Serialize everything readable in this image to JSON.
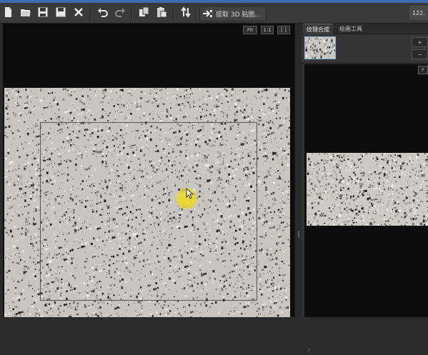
{
  "toolbar": {
    "buttons": [
      {
        "name": "new-file-icon"
      },
      {
        "name": "open-folder-icon"
      },
      {
        "name": "save-icon"
      },
      {
        "name": "save-as-icon"
      },
      {
        "name": "close-x-icon"
      },
      {
        "name": "undo-icon"
      },
      {
        "name": "redo-icon"
      },
      {
        "name": "copy-icon"
      },
      {
        "name": "paste-icon"
      },
      {
        "name": "swap-icon"
      }
    ],
    "extract_label": "提取 3D 贴图...",
    "zoom_readout": "122."
  },
  "viewport": {
    "fit_label": "Fit",
    "one_to_one_label": "1:1",
    "bracket_label": "[ ]"
  },
  "panel": {
    "tabs": [
      {
        "label": "纹理合成",
        "active": true
      },
      {
        "label": "绘画工具",
        "active": false
      }
    ],
    "plus_label": "+",
    "minus_label": "−",
    "preview_tag": "F",
    "help_label": "?"
  },
  "colors": {
    "accent_strip": "#3d6fb0",
    "toolbar_bg": "#3a3a3a",
    "viewport_bg": "#0d0d0d",
    "texture_base": "#c9c6c2",
    "selection_border": "#8aa9d6"
  }
}
